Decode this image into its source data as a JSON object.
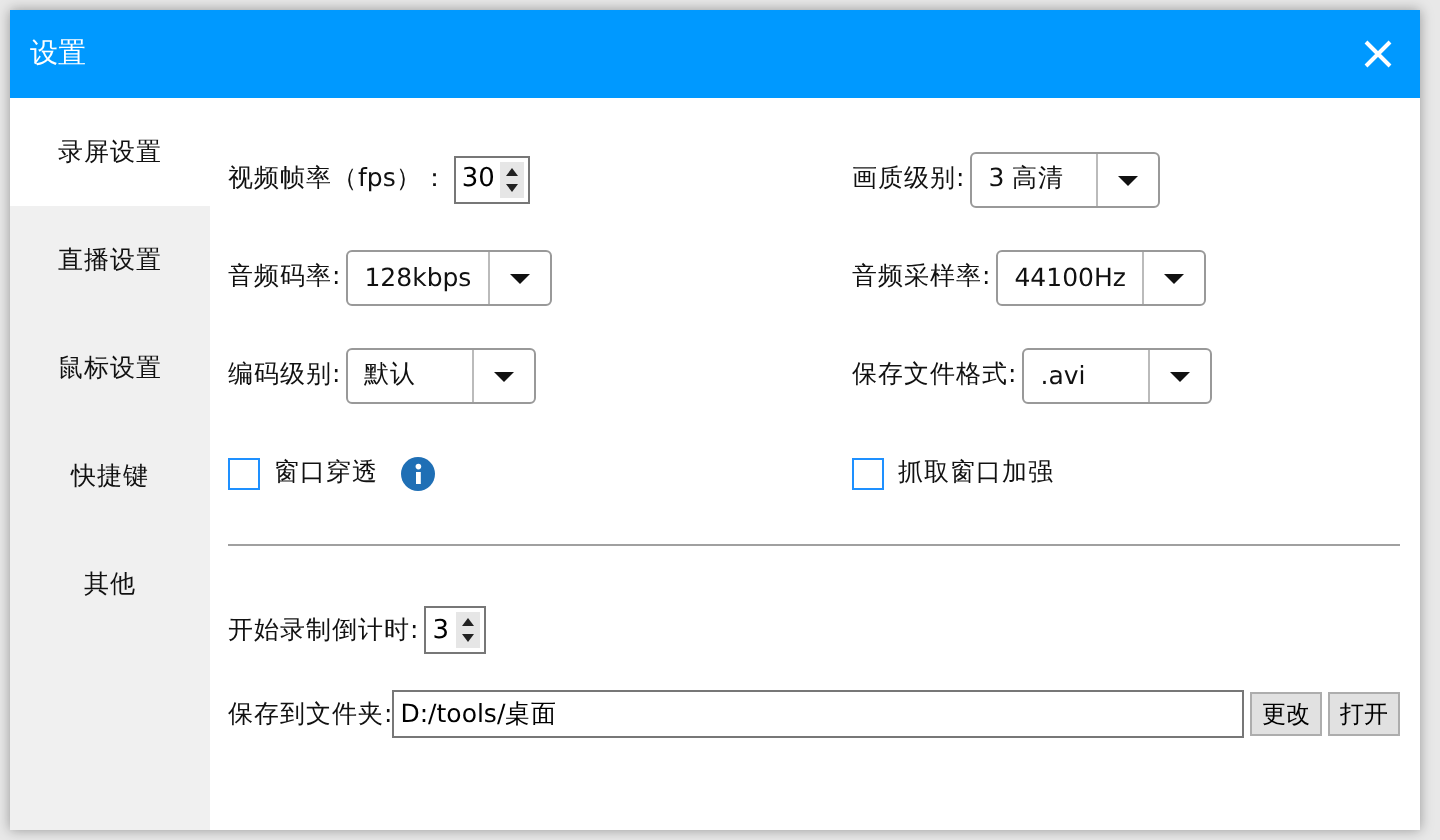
{
  "window": {
    "title": "设置"
  },
  "sidebar": {
    "items": [
      {
        "label": "录屏设置",
        "selected": true
      },
      {
        "label": "直播设置",
        "selected": false
      },
      {
        "label": "鼠标设置",
        "selected": false
      },
      {
        "label": "快捷键",
        "selected": false
      },
      {
        "label": "其他",
        "selected": false
      }
    ]
  },
  "left_fields": [
    {
      "kind": "spinner",
      "label": "视频帧率（fps）：",
      "value": "30"
    },
    {
      "kind": "select",
      "label": "音频码率:",
      "value": "128kbps"
    },
    {
      "kind": "select",
      "label": "编码级别:",
      "value": "默认"
    },
    {
      "kind": "checkbox",
      "label": "窗口穿透",
      "checked": false,
      "info": true
    }
  ],
  "right_fields": [
    {
      "kind": "select",
      "label": "画质级别:",
      "value": "3 高清"
    },
    {
      "kind": "select",
      "label": "音频采样率:",
      "value": "44100Hz"
    },
    {
      "kind": "select",
      "label": "保存文件格式:",
      "value": ".avi"
    },
    {
      "kind": "checkbox",
      "label": "抓取窗口加强",
      "checked": false,
      "info": false
    }
  ],
  "countdown": {
    "label": "开始录制倒计时:",
    "value": "3"
  },
  "save_folder": {
    "label": "保存到文件夹:",
    "value": "D:/tools/桌面",
    "buttons": [
      "更改",
      "打开"
    ]
  }
}
